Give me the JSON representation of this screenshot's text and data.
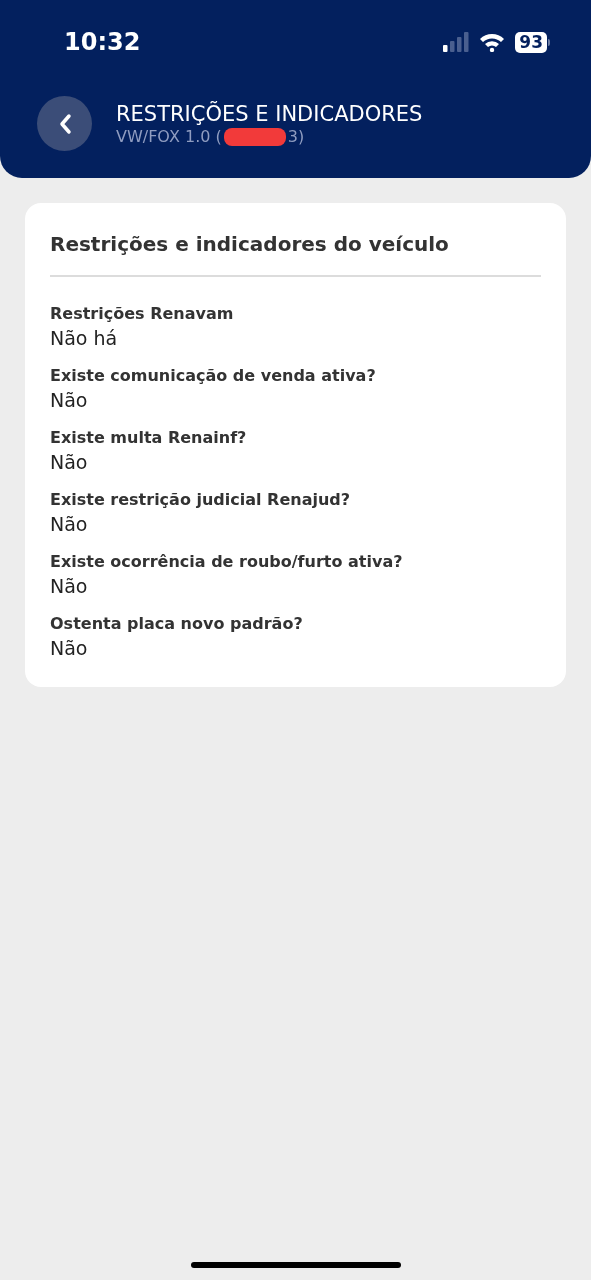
{
  "status_bar": {
    "time": "10:32",
    "battery": "93"
  },
  "header": {
    "title": "RESTRIÇÕES E INDICADORES",
    "subtitle_start": "VW/FOX 1.0 (",
    "subtitle_end": "3)"
  },
  "card": {
    "title": "Restrições e indicadores do veículo",
    "fields": [
      {
        "label": "Restrições Renavam",
        "value": "Não há"
      },
      {
        "label": "Existe comunicação de venda ativa?",
        "value": "Não"
      },
      {
        "label": "Existe multa Renainf?",
        "value": "Não"
      },
      {
        "label": "Existe restrição judicial Renajud?",
        "value": "Não"
      },
      {
        "label": "Existe ocorrência de roubo/furto ativa?",
        "value": "Não"
      },
      {
        "label": "Ostenta placa novo padrão?",
        "value": "Não"
      }
    ]
  }
}
